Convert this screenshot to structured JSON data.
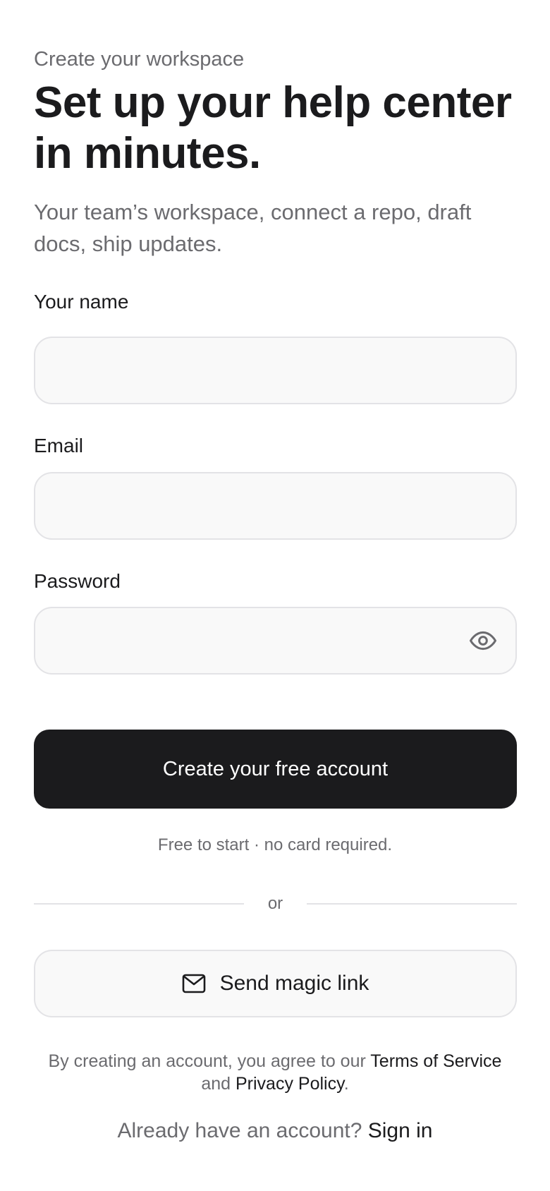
{
  "header": {
    "eyebrow": "Create your workspace",
    "headline": "Set up your help center in minutes.",
    "subtitle": "Your team’s workspace, connect a repo, draft docs, ship updates."
  },
  "form": {
    "name": {
      "label": "Your name",
      "value": "",
      "placeholder": ""
    },
    "email": {
      "label": "Email",
      "value": "",
      "placeholder": ""
    },
    "password": {
      "label": "Password",
      "value": "",
      "placeholder": "",
      "toggle_icon": "eye-icon"
    },
    "submit_label": "Create your free account",
    "note": "Free to start · no card required."
  },
  "divider": {
    "label": "or"
  },
  "magic_link": {
    "label": "Send magic link",
    "icon": "mail-icon"
  },
  "legal": {
    "prefix": "By creating an account, you agree to our ",
    "terms": "Terms of Service",
    "middle": " and ",
    "privacy": "Privacy Policy",
    "suffix": "."
  },
  "signin": {
    "prompt": "Already have an account? ",
    "link": "Sign in"
  },
  "colors": {
    "primary": "#1b1b1d",
    "muted_text": "#6b6b6f",
    "field_bg": "#f9f9f9",
    "border": "#e3e3e6"
  }
}
